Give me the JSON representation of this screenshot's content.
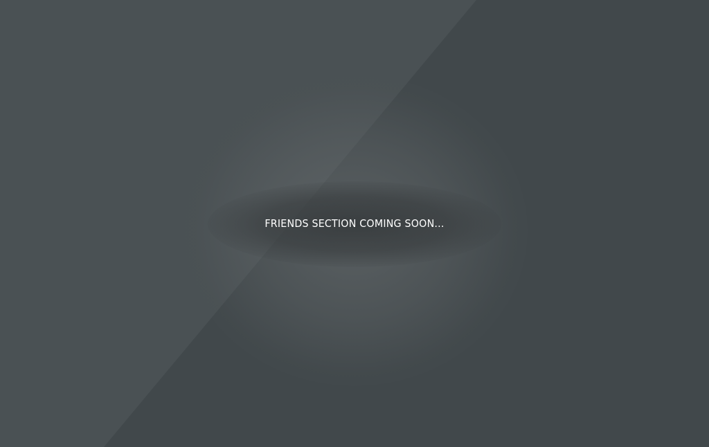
{
  "message": {
    "text": "FRIENDS SECTION COMING SOON..."
  },
  "colors": {
    "background_dark": "#41484b",
    "background_light": "#4a5154",
    "text": "#ffffff"
  }
}
